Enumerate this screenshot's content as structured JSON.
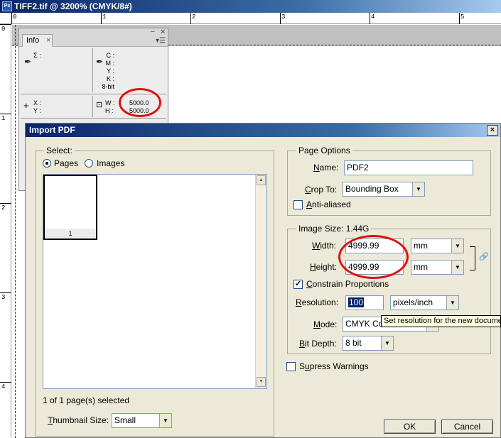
{
  "document": {
    "title": "TIFF2.tif @ 3200% (CMYK/8#)",
    "app_icon": "Ps",
    "h_ruler_ticks": [
      "0",
      "1",
      "2",
      "3",
      "4",
      "5"
    ],
    "v_ruler_ticks": [
      "0",
      "1",
      "2",
      "3",
      "4"
    ]
  },
  "info_panel": {
    "tab_label": "Info",
    "tab_close": "×",
    "left_col_sigma": "Σ :",
    "right_col_labels": "C :\nM :\nY :\nK :\n8-bit",
    "xy_labels": "X :\nY :",
    "w_label": "W :",
    "h_label": "H :",
    "w_value": "5000.0",
    "h_value": "5000.0"
  },
  "dialog": {
    "title": "Import PDF",
    "close_glyph": "×",
    "select_group": "Select:",
    "pages_label": "Pages",
    "images_label": "Images",
    "pages_selected": true,
    "thumbnail_page_number": "1",
    "pages_status": "1 of 1 page(s) selected",
    "thumbnail_size_label": "Thumbnail Size:",
    "thumbnail_size_value": "Small",
    "page_options_group": "Page Options",
    "name_label": "Name:",
    "name_value": "PDF2",
    "crop_to_label": "Crop To:",
    "crop_to_value": "Bounding Box",
    "anti_aliased_label": "Anti-aliased",
    "anti_aliased_checked": false,
    "image_size_group": "Image Size: 1.44G",
    "width_label": "Width:",
    "width_value": "4999.99",
    "width_unit": "mm",
    "height_label": "Height:",
    "height_value": "4999.99",
    "height_unit": "mm",
    "constrain_label": "Constrain Proportions",
    "constrain_checked": true,
    "resolution_label": "Resolution:",
    "resolution_value": "100",
    "resolution_unit": "pixels/inch",
    "tooltip_text": "Set resolution for the new docume",
    "mode_label": "Mode:",
    "mode_value": "CMYK Co",
    "bit_depth_label": "Bit Depth:",
    "bit_depth_value": "8 bit",
    "suppress_label": "Supress Warnings",
    "suppress_checked": false,
    "ok_label": "OK",
    "cancel_label": "Cancel"
  },
  "colors": {
    "title_blue": "#0a246a",
    "dialog_bg": "#ece9d8",
    "annotation_red": "#e01010"
  }
}
